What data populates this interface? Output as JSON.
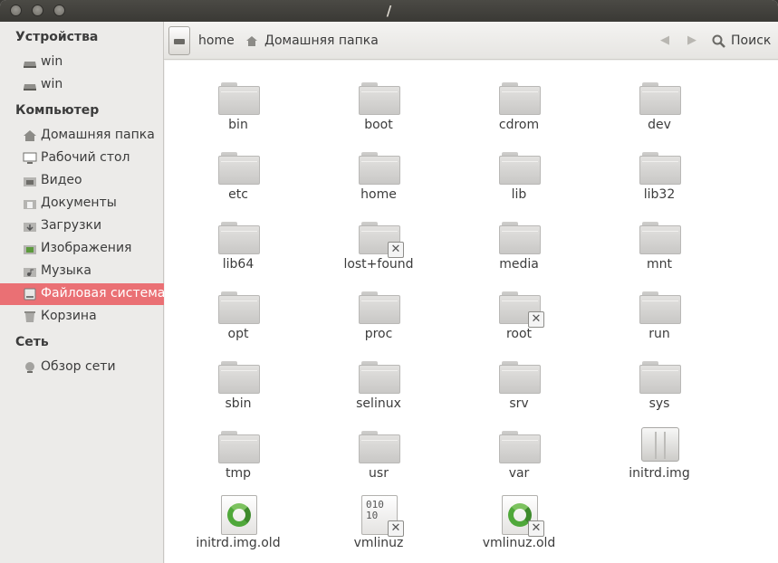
{
  "window": {
    "title": "/"
  },
  "sidebar": {
    "devices_heading": "Устройства",
    "devices": [
      {
        "label": "win",
        "icon": "drive-icon"
      },
      {
        "label": "win",
        "icon": "drive-icon"
      }
    ],
    "computer_heading": "Компьютер",
    "computer": [
      {
        "label": "Домашняя папка",
        "icon": "home-icon"
      },
      {
        "label": "Рабочий стол",
        "icon": "desktop-icon"
      },
      {
        "label": "Видео",
        "icon": "video-folder-icon"
      },
      {
        "label": "Документы",
        "icon": "documents-folder-icon"
      },
      {
        "label": "Загрузки",
        "icon": "downloads-folder-icon"
      },
      {
        "label": "Изображения",
        "icon": "pictures-folder-icon"
      },
      {
        "label": "Музыка",
        "icon": "music-folder-icon"
      },
      {
        "label": "Файловая система",
        "icon": "filesystem-icon",
        "active": true
      },
      {
        "label": "Корзина",
        "icon": "trash-icon"
      }
    ],
    "network_heading": "Сеть",
    "network": [
      {
        "label": "Обзор сети",
        "icon": "network-icon"
      }
    ],
    "active_color": "#ea7074"
  },
  "toolbar": {
    "breadcrumb_home": "home",
    "breadcrumb_folder": "Домашняя папка",
    "back_icon": "arrow-left-icon",
    "forward_icon": "arrow-right-icon",
    "search_label": "Поиск"
  },
  "files": [
    {
      "name": "bin",
      "type": "folder"
    },
    {
      "name": "boot",
      "type": "folder"
    },
    {
      "name": "cdrom",
      "type": "folder"
    },
    {
      "name": "dev",
      "type": "folder"
    },
    {
      "name": "etc",
      "type": "folder"
    },
    {
      "name": "home",
      "type": "folder"
    },
    {
      "name": "lib",
      "type": "folder"
    },
    {
      "name": "lib32",
      "type": "folder"
    },
    {
      "name": "lib64",
      "type": "folder"
    },
    {
      "name": "lost+found",
      "type": "folder",
      "locked": true
    },
    {
      "name": "media",
      "type": "folder"
    },
    {
      "name": "mnt",
      "type": "folder"
    },
    {
      "name": "opt",
      "type": "folder"
    },
    {
      "name": "proc",
      "type": "folder"
    },
    {
      "name": "root",
      "type": "folder",
      "locked": true
    },
    {
      "name": "run",
      "type": "folder"
    },
    {
      "name": "sbin",
      "type": "folder"
    },
    {
      "name": "selinux",
      "type": "folder"
    },
    {
      "name": "srv",
      "type": "folder"
    },
    {
      "name": "sys",
      "type": "folder"
    },
    {
      "name": "tmp",
      "type": "folder"
    },
    {
      "name": "usr",
      "type": "folder"
    },
    {
      "name": "var",
      "type": "folder"
    },
    {
      "name": "initrd.img",
      "type": "archive"
    },
    {
      "name": "initrd.img.old",
      "type": "recycle"
    },
    {
      "name": "vmlinuz",
      "type": "binary",
      "locked": true
    },
    {
      "name": "vmlinuz.old",
      "type": "recycle",
      "locked": true
    }
  ],
  "binary_glyph": "010\n10"
}
